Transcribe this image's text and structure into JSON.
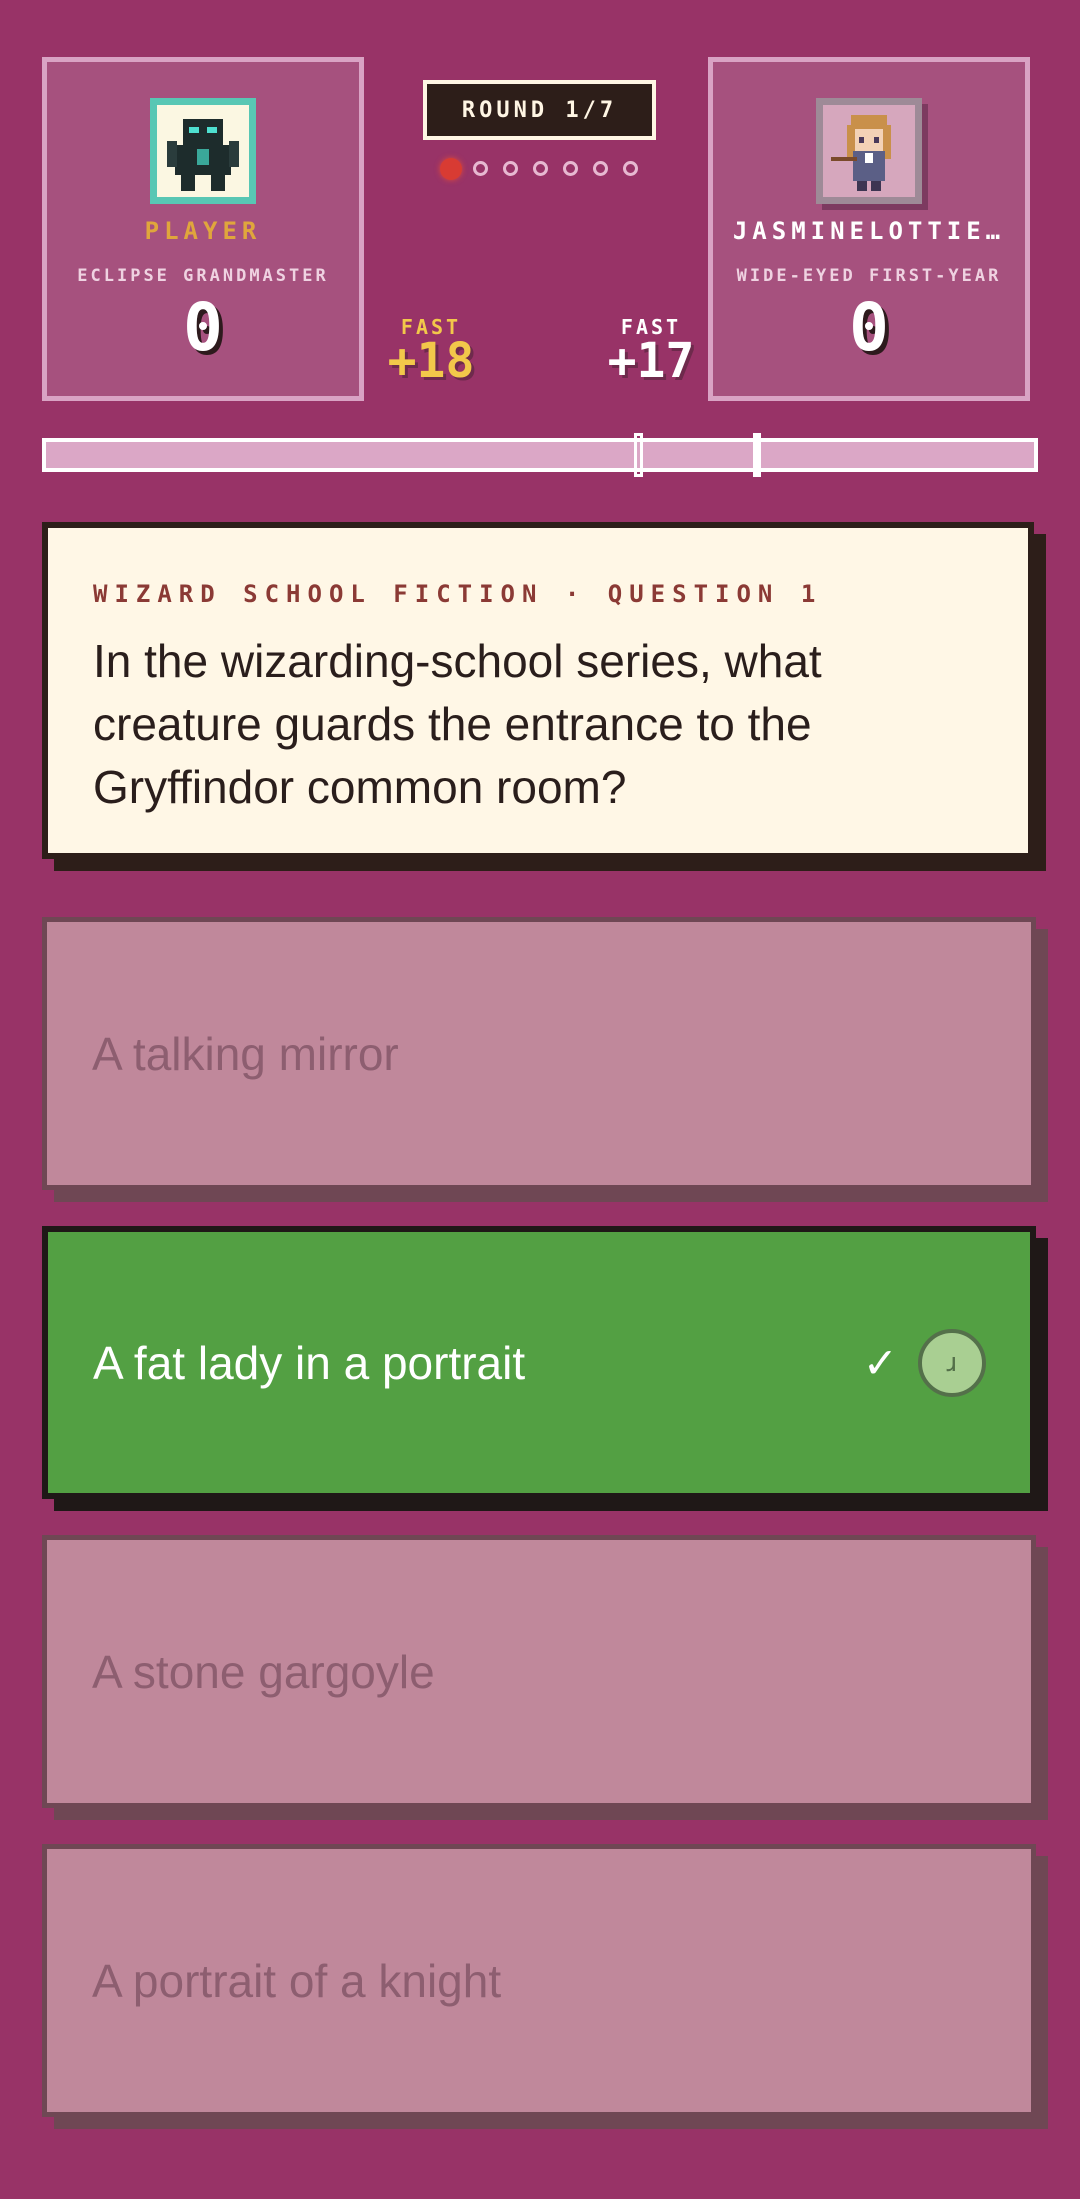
{
  "colors": {
    "background": "#983367",
    "card": "#a6517e",
    "correct": "#53a043",
    "dim_answer": "#c0889b",
    "question_bg": "#fff7e6",
    "accent_gold": "#e0a63c"
  },
  "player": {
    "name": "PLAYER",
    "title": "ECLIPSE GRANDMASTER",
    "score": "0",
    "avatar_icon": "dark-knight-avatar-icon",
    "fast_label": "FAST",
    "fast_bonus": "+18"
  },
  "opponent": {
    "name": "JASMINELOTTIE…",
    "title": "WIDE-EYED FIRST-YEAR",
    "score": "0",
    "avatar_icon": "wizard-girl-avatar-icon",
    "fast_label": "FAST",
    "fast_bonus": "+17"
  },
  "round": {
    "label": "ROUND 1/7",
    "current": 1,
    "total": 7
  },
  "progress": {
    "player_marker_fraction": 0.6,
    "opponent_marker_fraction": 0.72
  },
  "question": {
    "category": "WIZARD SCHOOL FICTION · QUESTION 1",
    "text": "In the wizarding-school series, what creature guards the entrance to the Gryffindor common room?"
  },
  "answers": [
    {
      "text": "A talking mirror",
      "state": "dim"
    },
    {
      "text": "A fat lady in a portrait",
      "state": "correct",
      "check": "✓",
      "chip": "ɹ"
    },
    {
      "text": "A stone gargoyle",
      "state": "dim"
    },
    {
      "text": "A portrait of a knight",
      "state": "dim"
    }
  ]
}
